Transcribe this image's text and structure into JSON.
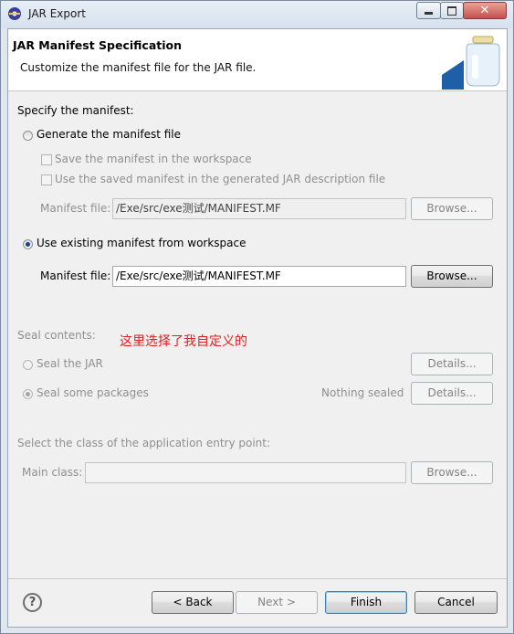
{
  "window": {
    "title": "JAR Export",
    "close_glyph": "✕"
  },
  "banner": {
    "title": "JAR Manifest Specification",
    "description": "Customize the manifest file for the JAR file."
  },
  "manifest": {
    "section_label": "Specify the manifest:",
    "generate_label": "Generate the manifest file",
    "save_in_workspace_label": "Save the manifest in the workspace",
    "use_saved_label": "Use the saved manifest in the generated JAR description file",
    "generated_file_label": "Manifest file:",
    "generated_file_value": "/Exe/src/exe测试/MANIFEST.MF",
    "browse_label": "Browse...",
    "use_existing_label": "Use existing manifest from workspace",
    "existing_file_label": "Manifest file:",
    "existing_file_value": "/Exe/src/exe测试/MANIFEST.MF",
    "selected_option": "use_existing"
  },
  "annotation": "这里选择了我自定义的",
  "seal": {
    "section_label": "Seal contents:",
    "seal_jar_label": "Seal the JAR",
    "seal_packages_label": "Seal some packages",
    "status": "Nothing sealed",
    "details_label": "Details..."
  },
  "entry_point": {
    "section_label": "Select the class of the application entry point:",
    "main_class_label": "Main class:",
    "main_class_value": "",
    "browse_label": "Browse..."
  },
  "footer": {
    "help_glyph": "?",
    "back_label": "< Back",
    "next_label": "Next >",
    "finish_label": "Finish",
    "cancel_label": "Cancel"
  },
  "icons": {
    "app": "eclipse-icon",
    "banner": "jar-icon",
    "help": "help-icon"
  }
}
